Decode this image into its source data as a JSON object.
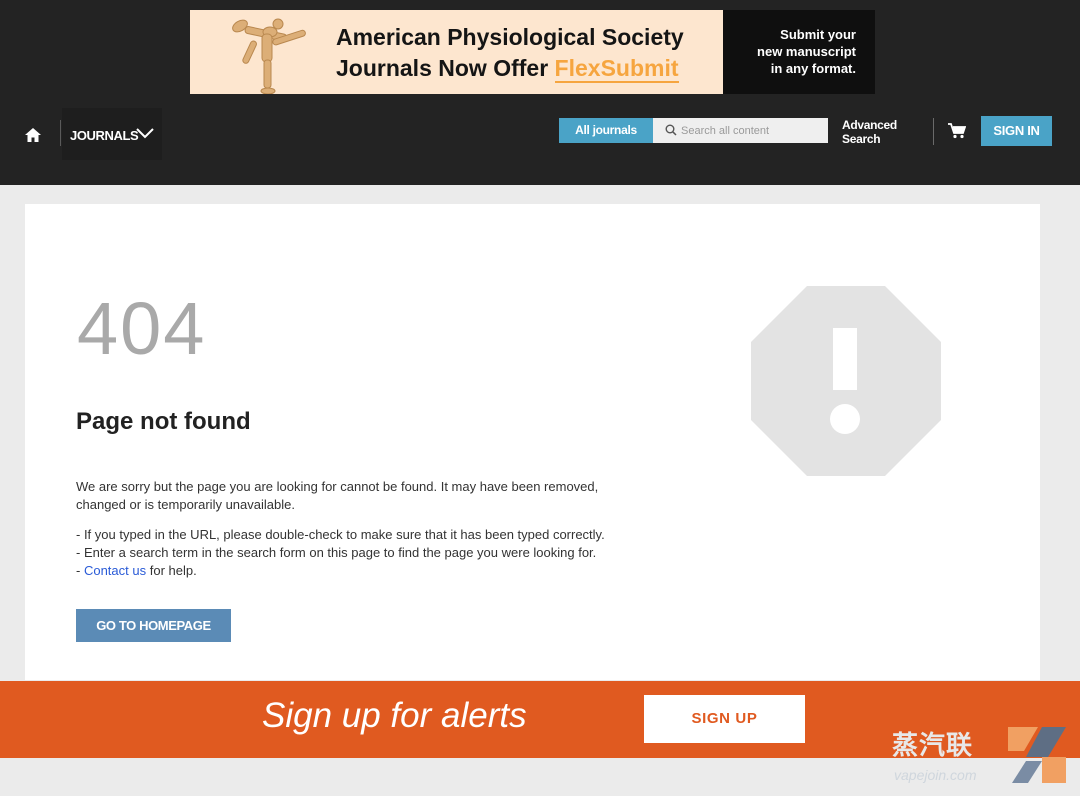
{
  "ad": {
    "headline_line1": "American Physiological Society",
    "headline_line2": "Journals Now Offer ",
    "headline_highlight": "FlexSubmit",
    "cta_line1": "Submit your",
    "cta_line2": "new manuscript",
    "cta_line3": "in any format."
  },
  "nav": {
    "journals_label": "JOURNALS",
    "all_journals_label": "All journals",
    "search_placeholder": "Search all content",
    "advanced_line1": "Advanced",
    "advanced_line2": "Search",
    "sign_in_label": "SIGN IN"
  },
  "error": {
    "code": "404",
    "title": "Page not found",
    "description": "We are sorry but the page you are looking for cannot be found. It may have been removed, changed or is temporarily unavailable.",
    "tip1": "- If you typed in the URL, please double-check to make sure that it has been typed correctly.",
    "tip2": "- Enter a search term in the search form on this page to find the page you were looking for.",
    "tip3_prefix": "- ",
    "tip3_link": "Contact us",
    "tip3_suffix": " for help.",
    "home_button": "GO TO HOMEPAGE"
  },
  "alerts": {
    "text": "Sign up for alerts",
    "button": "SIGN UP"
  },
  "watermark": {
    "cn": "蒸汽联",
    "url": "vapejoin.com"
  },
  "colors": {
    "topbar": "#232323",
    "accent_blue": "#4aa3c7",
    "button_blue": "#5b8bb6",
    "alerts_orange": "#e05a20",
    "flexsubmit_orange": "#f6a53f"
  },
  "icons": [
    "home-icon",
    "chevron-down-icon",
    "search-icon",
    "cart-icon",
    "warning-octagon-icon"
  ]
}
